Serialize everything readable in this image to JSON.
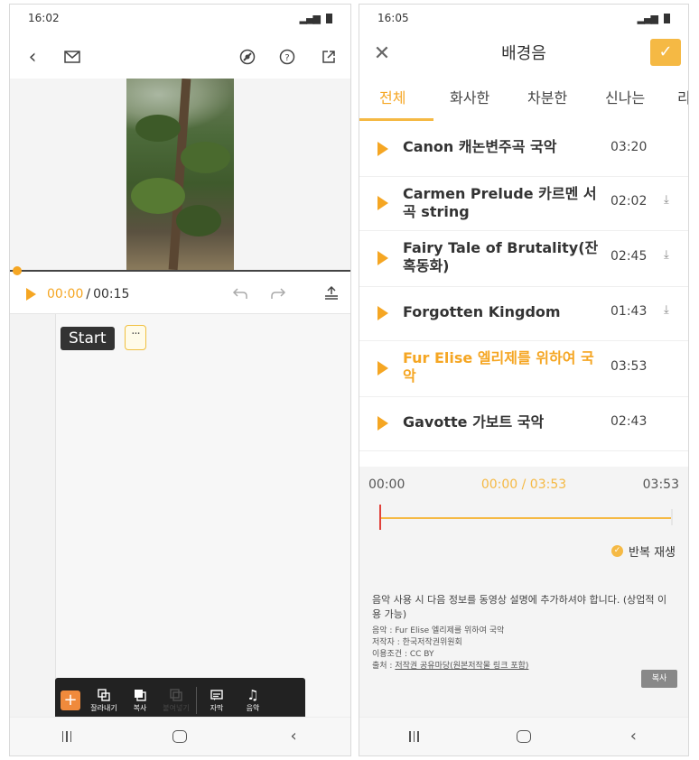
{
  "left_phone": {
    "status": {
      "time": "16:02"
    },
    "toolbar": {
      "back_icon": "chevron-left-icon",
      "mail_icon": "mail-icon",
      "filter_icon": "filter-icon",
      "help_icon": "question-circle-icon",
      "share_icon": "open-external-icon"
    },
    "player": {
      "current_time": "00:00",
      "separator": "/",
      "total_time": "00:15"
    },
    "timeline": {
      "start_label": "Start",
      "more_label": "···"
    },
    "edit_toolbar": {
      "add_label": "+",
      "tools": [
        {
          "label": "잘라내기",
          "icon": "cut-icon",
          "enabled": true
        },
        {
          "label": "복사",
          "icon": "copy-icon",
          "enabled": true
        },
        {
          "label": "붙여넣기",
          "icon": "paste-icon",
          "enabled": false
        },
        {
          "label": "자막",
          "icon": "subtitle-icon",
          "enabled": true
        },
        {
          "label": "음악",
          "icon": "music-icon",
          "enabled": true
        }
      ]
    }
  },
  "right_phone": {
    "status": {
      "time": "16:05"
    },
    "header": {
      "title": "배경음",
      "close_symbol": "✕",
      "confirm_symbol": "✓"
    },
    "tabs": [
      "전체",
      "화사한",
      "차분한",
      "신나는",
      "리듬"
    ],
    "active_tab": 0,
    "tracks": [
      {
        "name": "Canon 캐논변주곡 국악",
        "duration": "03:20",
        "downloadable": false,
        "selected": false
      },
      {
        "name": "Carmen Prelude 카르멘 서곡 string",
        "duration": "02:02",
        "downloadable": true,
        "selected": false
      },
      {
        "name": "Fairy Tale of Brutality(잔혹동화)",
        "duration": "02:45",
        "downloadable": true,
        "selected": false
      },
      {
        "name": "Forgotten Kingdom",
        "duration": "01:43",
        "downloadable": true,
        "selected": false
      },
      {
        "name": "Fur Elise 엘리제를 위하여 국악",
        "duration": "03:53",
        "downloadable": false,
        "selected": true
      },
      {
        "name": "Gavotte 가보트 국악",
        "duration": "02:43",
        "downloadable": false,
        "selected": false
      }
    ],
    "range": {
      "start": "00:00",
      "current": "00:00 / 03:53",
      "end": "03:53",
      "position_fraction": 0
    },
    "repeat_label": "반복 재생",
    "info": {
      "main": "음악 사용 시 다음 정보를 동영상 설명에 추가하셔야 합니다. (상업적 이용 가능)",
      "music_line": "음악 : Fur Elise 엘리제를 위하여 국악",
      "author_line": "저작자 : 한국저작권위원회",
      "license_line": "이용조건 : CC BY",
      "source_prefix": "출처 : ",
      "source_link": "저작권 공유마당(원본저작물 링크 포함)"
    },
    "copy_button": "복사"
  },
  "colors": {
    "accent": "#f5a623",
    "accent_light": "#f5b944",
    "dark_toolbar": "#222222",
    "add_button": "#f08a3c",
    "range_marker": "#e0413a"
  }
}
